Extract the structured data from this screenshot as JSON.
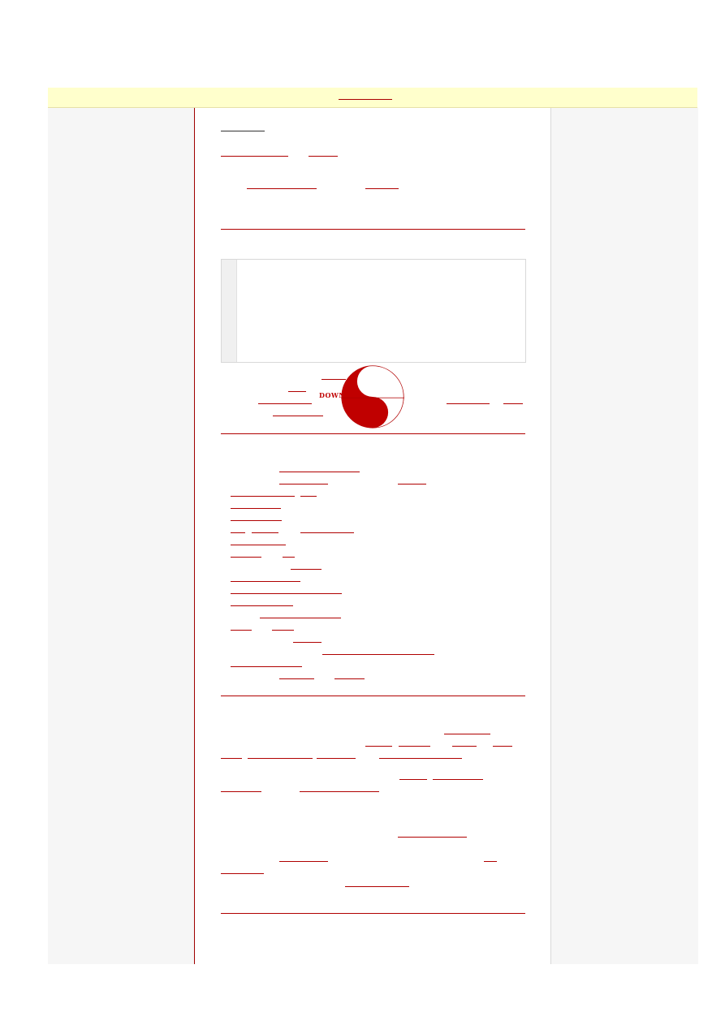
{
  "topbar": {
    "link_label": ""
  },
  "banner": {
    "download_label": "DOWN"
  },
  "colors": {
    "accent": "#b00000",
    "topbar_bg": "#ffffcc",
    "side_bg": "#f6f6f6"
  },
  "icons": {
    "logo": "yin-yang-icon"
  }
}
